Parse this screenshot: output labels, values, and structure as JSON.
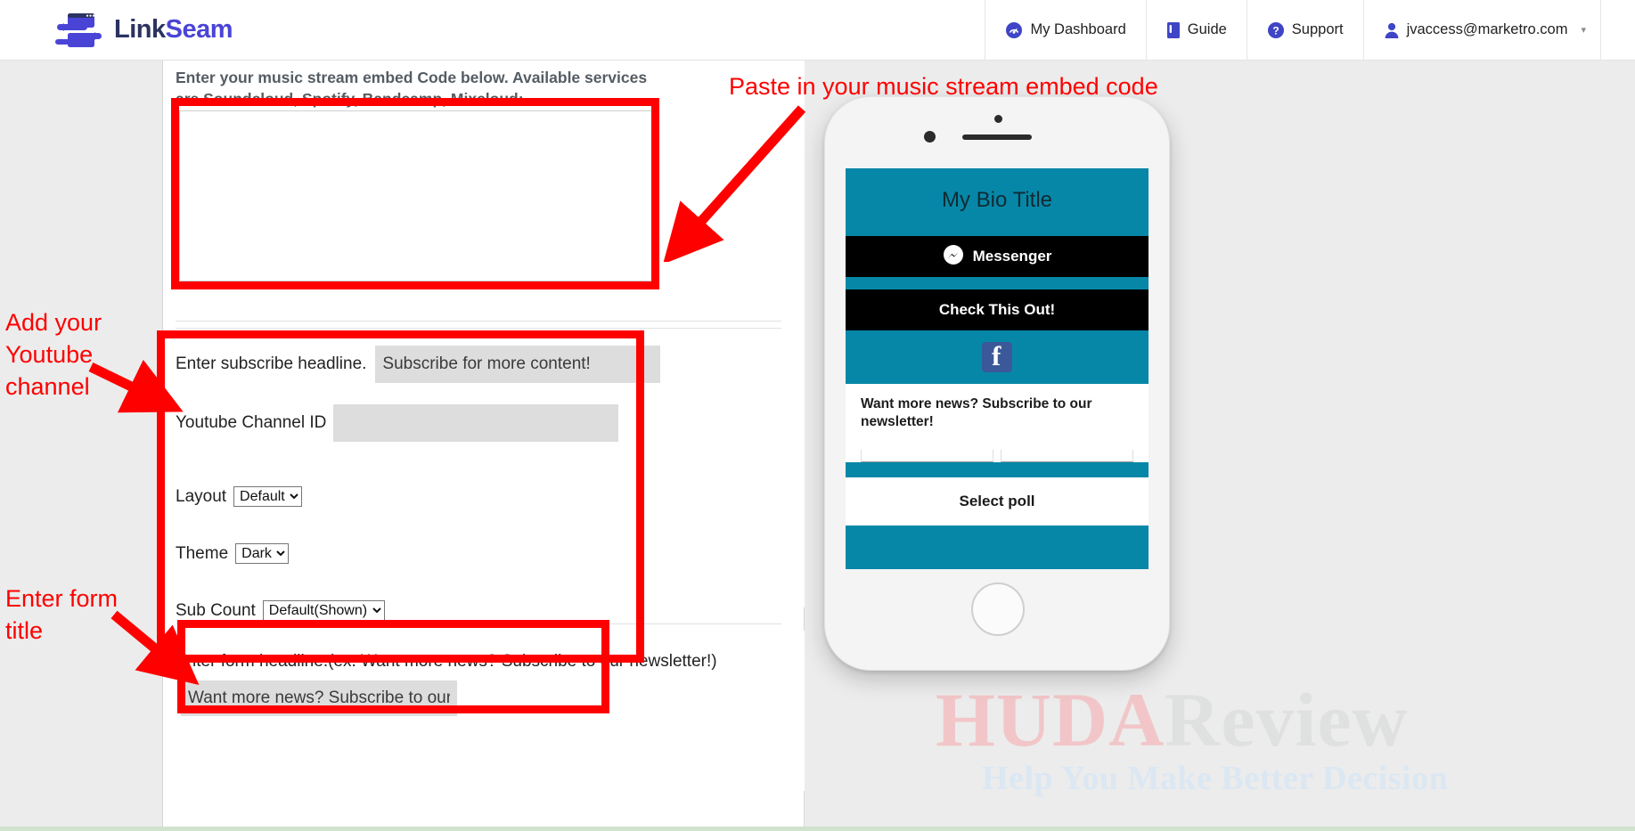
{
  "navbar": {
    "brand": {
      "part1": "Link",
      "part2": "Seam",
      "logo_icon": "linkseam-logo-icon"
    },
    "items": [
      {
        "label": "My Dashboard",
        "icon": "dashboard-icon"
      },
      {
        "label": "Guide",
        "icon": "book-icon"
      },
      {
        "label": "Support",
        "icon": "question-circle-icon"
      },
      {
        "label": "jvaccess@marketro.com",
        "icon": "user-icon",
        "caret": "▾"
      }
    ]
  },
  "form": {
    "embed_label": "Enter your music stream embed Code below. Available services are Soundcloud, Spotify, Bandcamp, Mixcloud:",
    "embed_value": "",
    "subscribe_headline_label": "Enter subscribe headline.",
    "subscribe_headline_value": "Subscribe for more content!",
    "youtube_channel_label": "Youtube Channel ID",
    "youtube_channel_value": "",
    "layout_label": "Layout",
    "layout_value": "Default",
    "layout_options": [
      "Default"
    ],
    "theme_label": "Theme",
    "theme_value": "Dark",
    "theme_options": [
      "Dark"
    ],
    "subcount_label": "Sub Count",
    "subcount_value": "Default(Shown)",
    "subcount_options": [
      "Default(Shown)"
    ],
    "form_headline_label": "Enter form headline.(ex. Want more news? Subscribe to our newsletter!)",
    "form_headline_value": "Want more news? Subscribe to our ne"
  },
  "annotations": [
    {
      "name": "paste-embed-code",
      "text": "Paste in your music stream embed code"
    },
    {
      "name": "add-youtube-channel",
      "text": "Add your\nYoutube\nchannel"
    },
    {
      "name": "enter-form-title",
      "text": "Enter form\ntitle"
    }
  ],
  "preview": {
    "bio_title": "My Bio Title",
    "messenger_button": "Messenger",
    "messenger_icon": "messenger-icon",
    "link_button": "Check This Out!",
    "facebook_icon": "facebook-icon",
    "form_headline": "Want more news? Subscribe to our newsletter!",
    "poll_label": "Select poll"
  },
  "watermark": {
    "part1": "HUDA",
    "part2": "Review",
    "tagline": "Help You Make Better Decision"
  },
  "colors": {
    "accent_red": "#fe0000",
    "brand_purple": "#4a44d6",
    "brand_navy": "#2b3360",
    "preview_teal": "#0787a8",
    "facebook_blue": "#3b5998"
  }
}
